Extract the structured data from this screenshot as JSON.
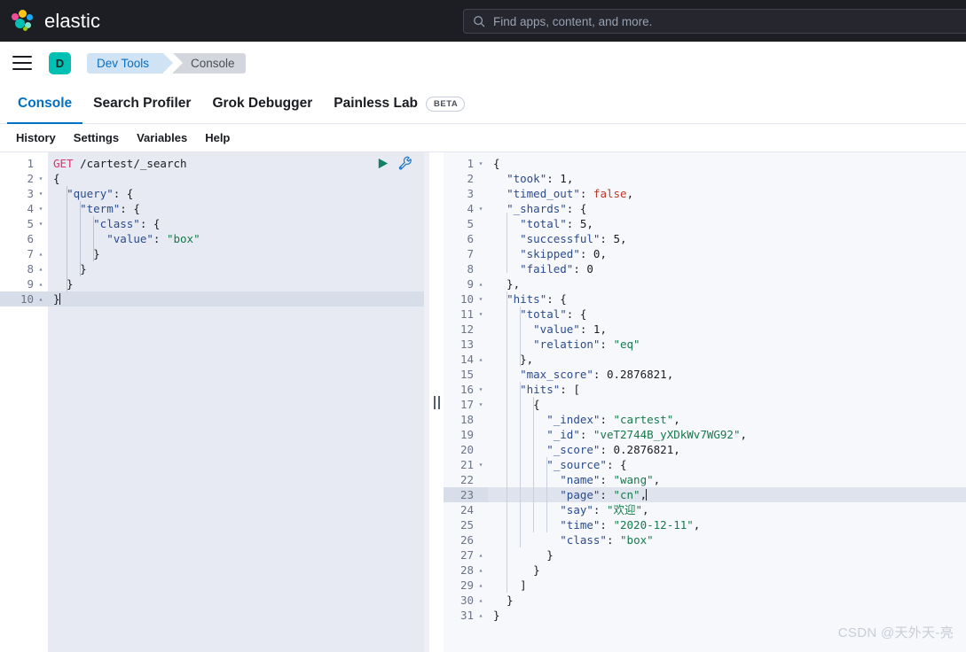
{
  "header": {
    "brand": "elastic",
    "logo_icon": "elastic-logo",
    "search": {
      "icon": "search-icon",
      "placeholder": "Find apps, content, and more."
    }
  },
  "breadcrumb_bar": {
    "menu_icon": "hamburger-menu-icon",
    "avatar_initial": "D",
    "crumbs": [
      {
        "label": "Dev Tools",
        "active": true
      },
      {
        "label": "Console",
        "active": false
      }
    ]
  },
  "tabs": [
    {
      "label": "Console",
      "active": true,
      "badge": ""
    },
    {
      "label": "Search Profiler",
      "active": false,
      "badge": ""
    },
    {
      "label": "Grok Debugger",
      "active": false,
      "badge": ""
    },
    {
      "label": "Painless Lab",
      "active": false,
      "badge": "BETA"
    }
  ],
  "submenu": [
    {
      "label": "History"
    },
    {
      "label": "Settings"
    },
    {
      "label": "Variables"
    },
    {
      "label": "Help"
    }
  ],
  "editor_actions": {
    "play_icon": "play-triangle-icon",
    "wrench_icon": "wrench-icon"
  },
  "request_editor": {
    "lines": [
      {
        "n": "1",
        "fold": "",
        "text": "GET /cartest/_search",
        "active": false
      },
      {
        "n": "2",
        "fold": "▾",
        "text": "{",
        "active": false
      },
      {
        "n": "3",
        "fold": "▾",
        "text": "  \"query\": {",
        "active": false
      },
      {
        "n": "4",
        "fold": "▾",
        "text": "    \"term\": {",
        "active": false
      },
      {
        "n": "5",
        "fold": "▾",
        "text": "      \"class\": {",
        "active": false
      },
      {
        "n": "6",
        "fold": "",
        "text": "        \"value\": \"box\"",
        "active": false
      },
      {
        "n": "7",
        "fold": "▴",
        "text": "      }",
        "active": false
      },
      {
        "n": "8",
        "fold": "▴",
        "text": "    }",
        "active": false
      },
      {
        "n": "9",
        "fold": "▴",
        "text": "  }",
        "active": false
      },
      {
        "n": "10",
        "fold": "▴",
        "text": "}",
        "active": true
      }
    ]
  },
  "response_viewer": {
    "lines": [
      {
        "n": "1",
        "fold": "▾",
        "text": "{",
        "active": false
      },
      {
        "n": "2",
        "fold": "",
        "text": "  \"took\": 1,",
        "active": false
      },
      {
        "n": "3",
        "fold": "",
        "text": "  \"timed_out\": false,",
        "active": false
      },
      {
        "n": "4",
        "fold": "▾",
        "text": "  \"_shards\": {",
        "active": false
      },
      {
        "n": "5",
        "fold": "",
        "text": "    \"total\": 5,",
        "active": false
      },
      {
        "n": "6",
        "fold": "",
        "text": "    \"successful\": 5,",
        "active": false
      },
      {
        "n": "7",
        "fold": "",
        "text": "    \"skipped\": 0,",
        "active": false
      },
      {
        "n": "8",
        "fold": "",
        "text": "    \"failed\": 0",
        "active": false
      },
      {
        "n": "9",
        "fold": "▴",
        "text": "  },",
        "active": false
      },
      {
        "n": "10",
        "fold": "▾",
        "text": "  \"hits\": {",
        "active": false
      },
      {
        "n": "11",
        "fold": "▾",
        "text": "    \"total\": {",
        "active": false
      },
      {
        "n": "12",
        "fold": "",
        "text": "      \"value\": 1,",
        "active": false
      },
      {
        "n": "13",
        "fold": "",
        "text": "      \"relation\": \"eq\"",
        "active": false
      },
      {
        "n": "14",
        "fold": "▴",
        "text": "    },",
        "active": false
      },
      {
        "n": "15",
        "fold": "",
        "text": "    \"max_score\": 0.2876821,",
        "active": false
      },
      {
        "n": "16",
        "fold": "▾",
        "text": "    \"hits\": [",
        "active": false
      },
      {
        "n": "17",
        "fold": "▾",
        "text": "      {",
        "active": false
      },
      {
        "n": "18",
        "fold": "",
        "text": "        \"_index\": \"cartest\",",
        "active": false
      },
      {
        "n": "19",
        "fold": "",
        "text": "        \"_id\": \"veT2744B_yXDkWv7WG92\",",
        "active": false
      },
      {
        "n": "20",
        "fold": "",
        "text": "        \"_score\": 0.2876821,",
        "active": false
      },
      {
        "n": "21",
        "fold": "▾",
        "text": "        \"_source\": {",
        "active": false
      },
      {
        "n": "22",
        "fold": "",
        "text": "          \"name\": \"wang\",",
        "active": false
      },
      {
        "n": "23",
        "fold": "",
        "text": "          \"page\": \"cn\",",
        "active": true
      },
      {
        "n": "24",
        "fold": "",
        "text": "          \"say\": \"欢迎\",",
        "active": false
      },
      {
        "n": "25",
        "fold": "",
        "text": "          \"time\": \"2020-12-11\",",
        "active": false
      },
      {
        "n": "26",
        "fold": "",
        "text": "          \"class\": \"box\"",
        "active": false
      },
      {
        "n": "27",
        "fold": "▴",
        "text": "        }",
        "active": false
      },
      {
        "n": "28",
        "fold": "▴",
        "text": "      }",
        "active": false
      },
      {
        "n": "29",
        "fold": "▴",
        "text": "    ]",
        "active": false
      },
      {
        "n": "30",
        "fold": "▴",
        "text": "  }",
        "active": false
      },
      {
        "n": "31",
        "fold": "▴",
        "text": "}",
        "active": false
      }
    ]
  },
  "splitter": {
    "icon": "vertical-drag-handle-icon"
  },
  "watermark": "CSDN @天外天-亮",
  "colors": {
    "header_bg": "#1d1e24",
    "accent_blue": "#0071c2",
    "avatar_teal": "#00bfb3",
    "method_pink": "#d6336c",
    "string_green": "#17794c",
    "key_blue": "#2a4b8d",
    "bool_red": "#c0392b",
    "editor_bg": "#e7eaf2",
    "response_bg": "#f7f8fc",
    "active_line": "#d7dde9"
  }
}
